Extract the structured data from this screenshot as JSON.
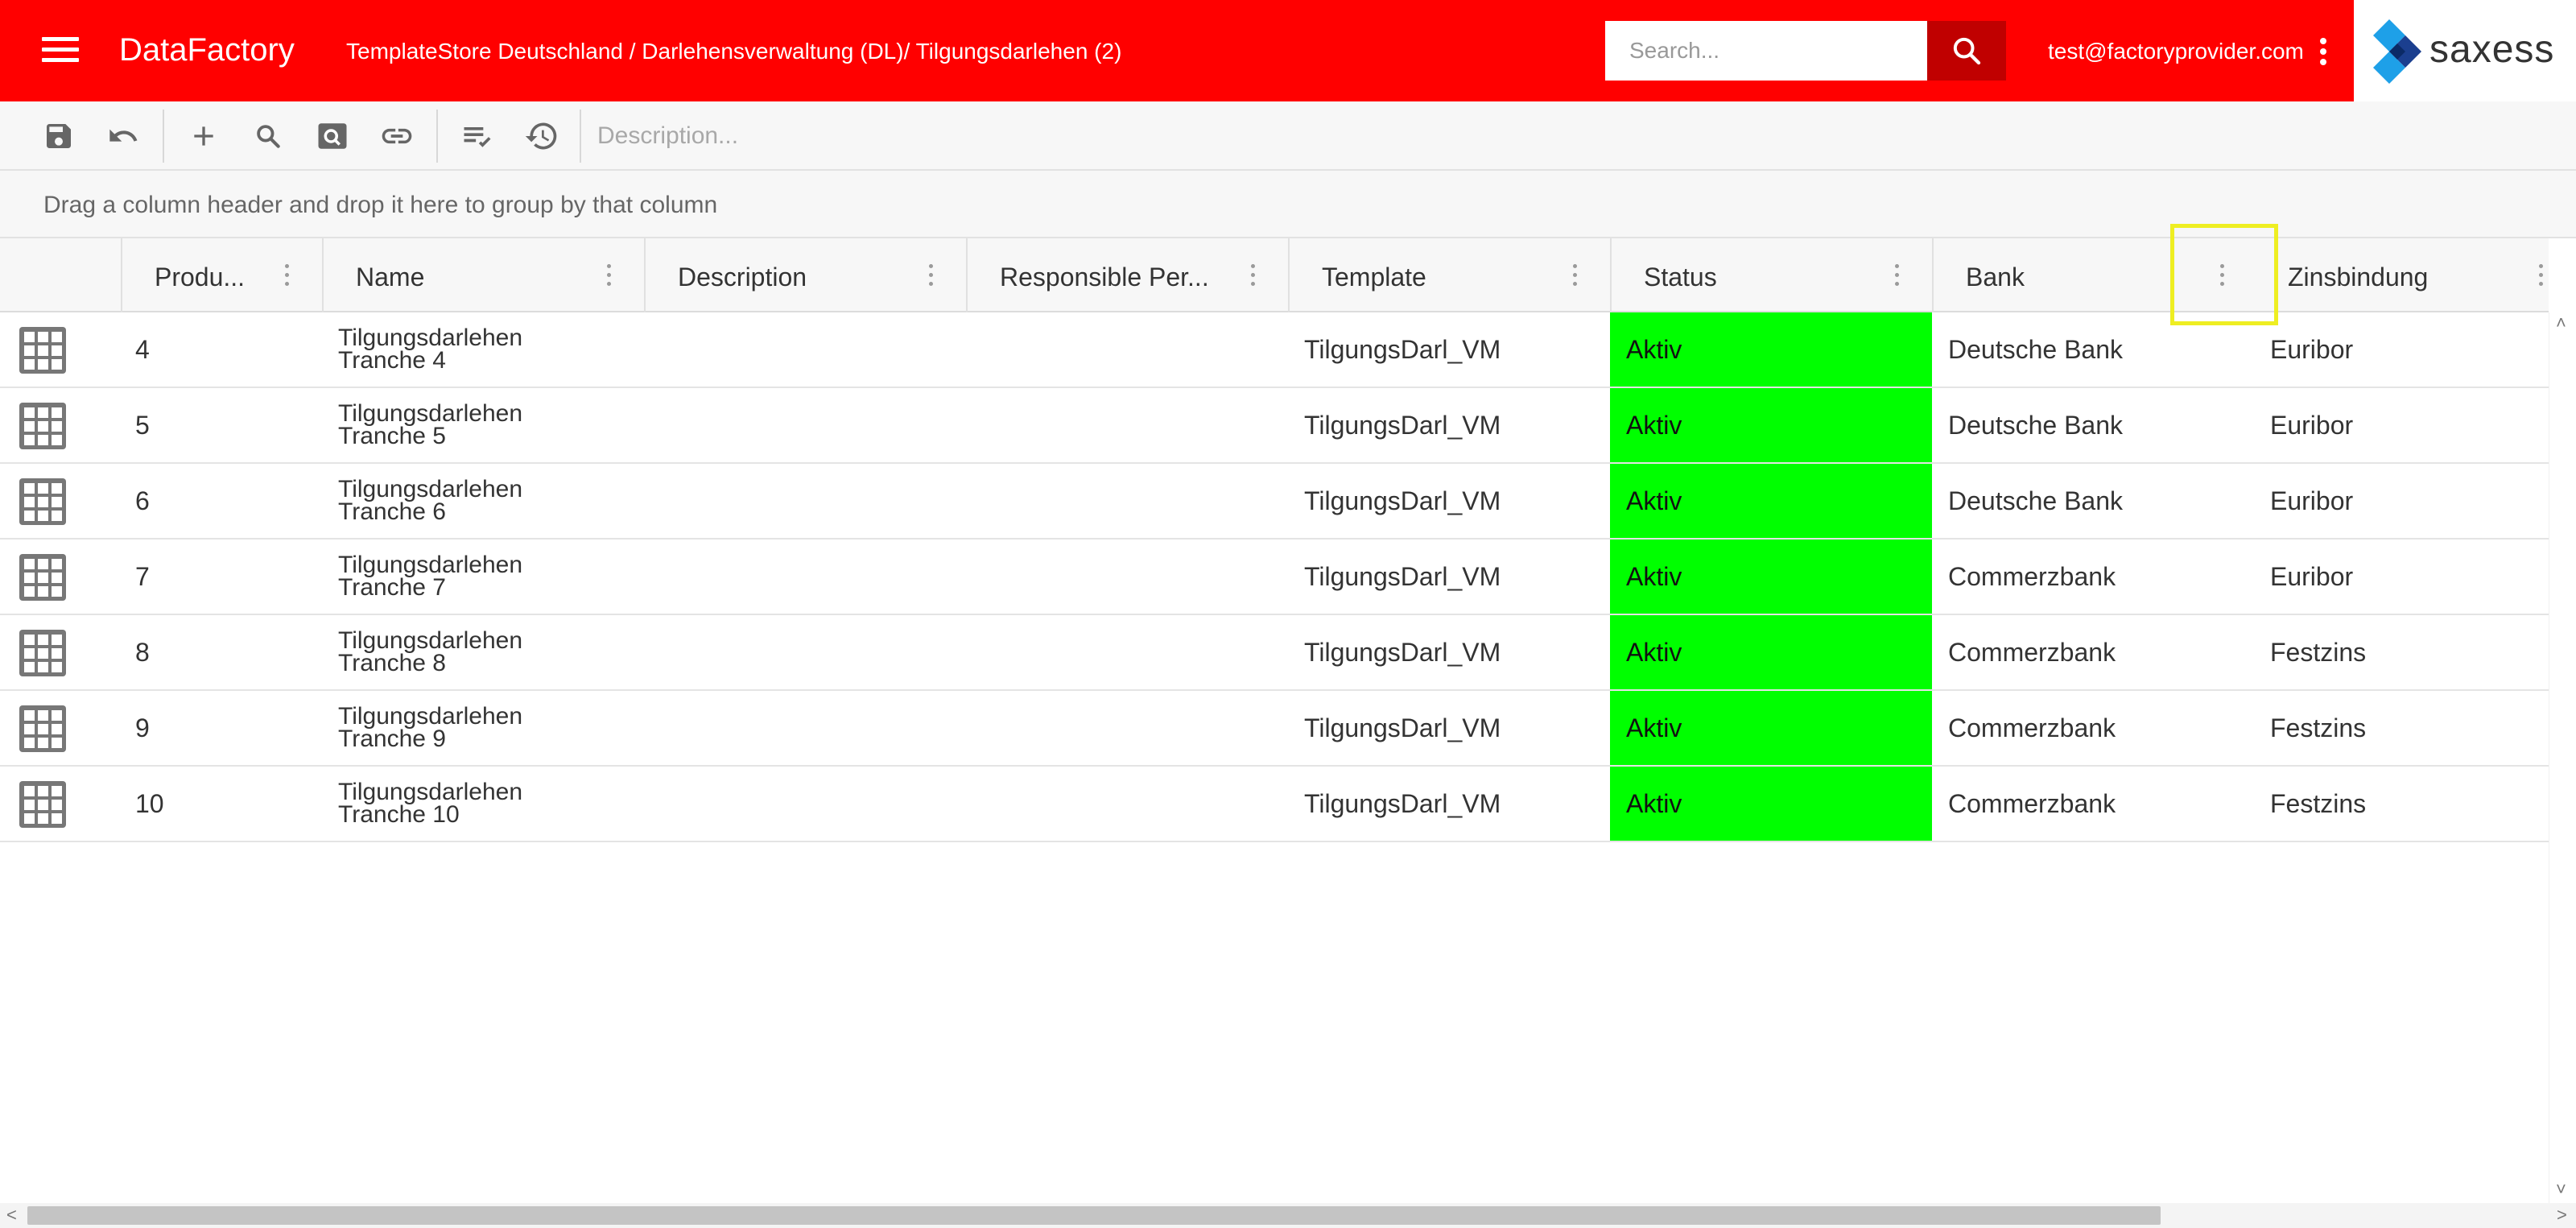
{
  "header": {
    "app_title": "DataFactory",
    "breadcrumb": "TemplateStore Deutschland / Darlehensverwaltung (DL)/ Tilgungsdarlehen (2)",
    "search_placeholder": "Search...",
    "user_email": "test@factoryprovider.com",
    "logo_text": "saxess",
    "colors": {
      "bar": "#ff0000",
      "search_button": "#c00000"
    }
  },
  "toolbar": {
    "buttons": [
      "save-icon",
      "undo-icon",
      "add-icon",
      "search-icon",
      "preview-icon",
      "link-icon",
      "checklist-icon",
      "history-icon"
    ],
    "description_placeholder": "Description..."
  },
  "group_panel": {
    "hint": "Drag a column header and drop it here to group by that column"
  },
  "grid": {
    "columns": [
      {
        "label": "Produ..."
      },
      {
        "label": "Name"
      },
      {
        "label": "Description"
      },
      {
        "label": "Responsible Per..."
      },
      {
        "label": "Template"
      },
      {
        "label": "Status"
      },
      {
        "label": "Bank"
      },
      {
        "label": "Zinsbindung"
      }
    ],
    "status_color": "#00ff00",
    "rows": [
      {
        "id": "4",
        "name_line1": "Tilgungsdarlehen",
        "name_line2": "Tranche 4",
        "template": "TilgungsDarl_VM",
        "status": "Aktiv",
        "bank": "Deutsche Bank",
        "zinsbindung": "Euribor"
      },
      {
        "id": "5",
        "name_line1": "Tilgungsdarlehen",
        "name_line2": "Tranche 5",
        "template": "TilgungsDarl_VM",
        "status": "Aktiv",
        "bank": "Deutsche Bank",
        "zinsbindung": "Euribor"
      },
      {
        "id": "6",
        "name_line1": "Tilgungsdarlehen",
        "name_line2": "Tranche 6",
        "template": "TilgungsDarl_VM",
        "status": "Aktiv",
        "bank": "Deutsche Bank",
        "zinsbindung": "Euribor"
      },
      {
        "id": "7",
        "name_line1": "Tilgungsdarlehen",
        "name_line2": "Tranche 7",
        "template": "TilgungsDarl_VM",
        "status": "Aktiv",
        "bank": "Commerzbank",
        "zinsbindung": "Euribor"
      },
      {
        "id": "8",
        "name_line1": "Tilgungsdarlehen",
        "name_line2": "Tranche 8",
        "template": "TilgungsDarl_VM",
        "status": "Aktiv",
        "bank": "Commerzbank",
        "zinsbindung": "Festzins"
      },
      {
        "id": "9",
        "name_line1": "Tilgungsdarlehen",
        "name_line2": "Tranche 9",
        "template": "TilgungsDarl_VM",
        "status": "Aktiv",
        "bank": "Commerzbank",
        "zinsbindung": "Festzins"
      },
      {
        "id": "10",
        "name_line1": "Tilgungsdarlehen",
        "name_line2": "Tranche 10",
        "template": "TilgungsDarl_VM",
        "status": "Aktiv",
        "bank": "Commerzbank",
        "zinsbindung": "Festzins"
      }
    ]
  }
}
